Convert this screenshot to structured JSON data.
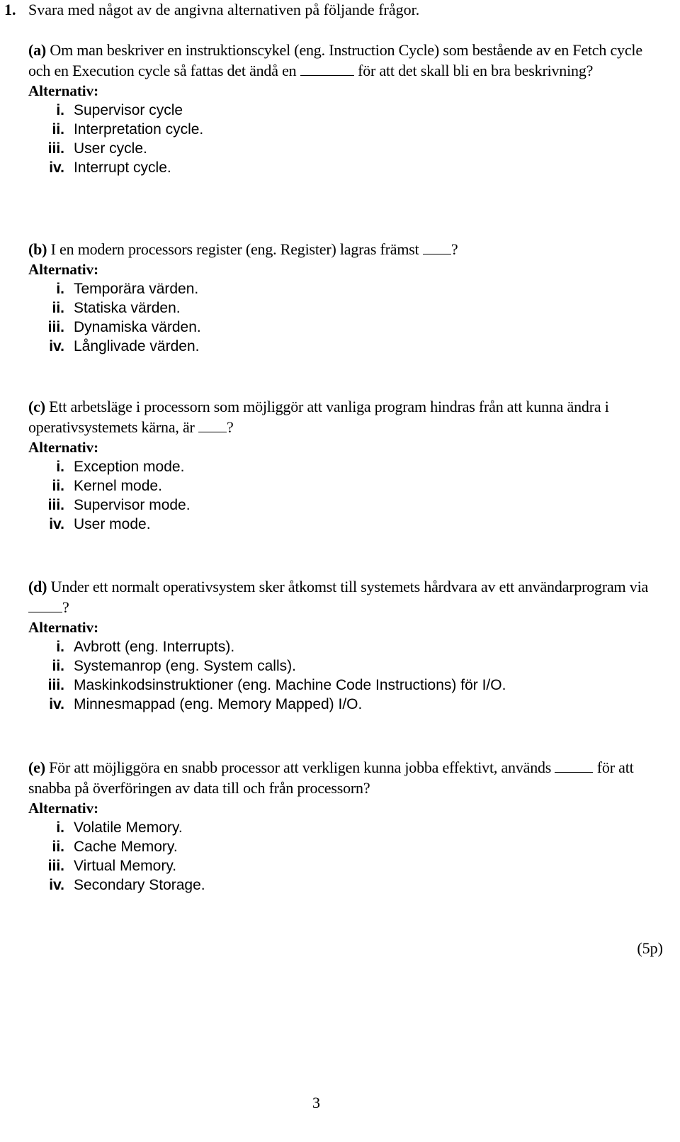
{
  "question": {
    "number": "1.",
    "instruction": "Svara med något av de angivna alternativen på följande frågor."
  },
  "alt_heading": "Alternativ:",
  "subquestions": [
    {
      "label": "(a)",
      "stem_before": "Om man beskriver en instruktionscykel (eng. Instruction Cycle) som bestående av en Fetch cycle och en Execution cycle så fattas det ändå en",
      "stem_after": "för att det skall bli en bra beskrivning?",
      "options": [
        {
          "roman": "i.",
          "text": "Supervisor cycle"
        },
        {
          "roman": "ii.",
          "text": "Interpretation cycle."
        },
        {
          "roman": "iii.",
          "text": "User cycle."
        },
        {
          "roman": "iv.",
          "text": "Interrupt cycle."
        }
      ]
    },
    {
      "label": "(b)",
      "stem_before": "I en modern processors register (eng. Register) lagras främst",
      "stem_after": "?",
      "options": [
        {
          "roman": "i.",
          "text": "Temporära värden."
        },
        {
          "roman": "ii.",
          "text": "Statiska värden."
        },
        {
          "roman": "iii.",
          "text": "Dynamiska värden."
        },
        {
          "roman": "iv.",
          "text": "Långlivade värden."
        }
      ]
    },
    {
      "label": "(c)",
      "stem_before": "Ett arbetsläge i processorn som möjliggör att vanliga program hindras från att kunna ändra i operativsystemets kärna, är",
      "stem_after": "?",
      "options": [
        {
          "roman": "i.",
          "text": "Exception mode."
        },
        {
          "roman": "ii.",
          "text": "Kernel mode."
        },
        {
          "roman": "iii.",
          "text": "Supervisor mode."
        },
        {
          "roman": "iv.",
          "text": "User mode."
        }
      ]
    },
    {
      "label": "(d)",
      "stem_before": "Under ett normalt operativsystem sker åtkomst till systemets hårdvara av ett användarprogram via",
      "stem_after": "?",
      "options": [
        {
          "roman": "i.",
          "text": "Avbrott (eng. Interrupts)."
        },
        {
          "roman": "ii.",
          "text": "Systemanrop (eng. System calls)."
        },
        {
          "roman": "iii.",
          "text": "Maskinkodsinstruktioner (eng. Machine Code Instructions) för I/O."
        },
        {
          "roman": "iv.",
          "text": "Minnesmappad (eng. Memory Mapped) I/O."
        }
      ]
    },
    {
      "label": "(e)",
      "stem_before": "För att möjliggöra en snabb processor att verkligen kunna jobba effektivt, används",
      "stem_after": "för att snabba på överföringen av data till och från processorn?",
      "options": [
        {
          "roman": "i.",
          "text": "Volatile Memory."
        },
        {
          "roman": "ii.",
          "text": "Cache Memory."
        },
        {
          "roman": "iii.",
          "text": "Virtual Memory."
        },
        {
          "roman": "iv.",
          "text": "Secondary Storage."
        }
      ]
    }
  ],
  "points": "(5p)",
  "page_number": "3"
}
